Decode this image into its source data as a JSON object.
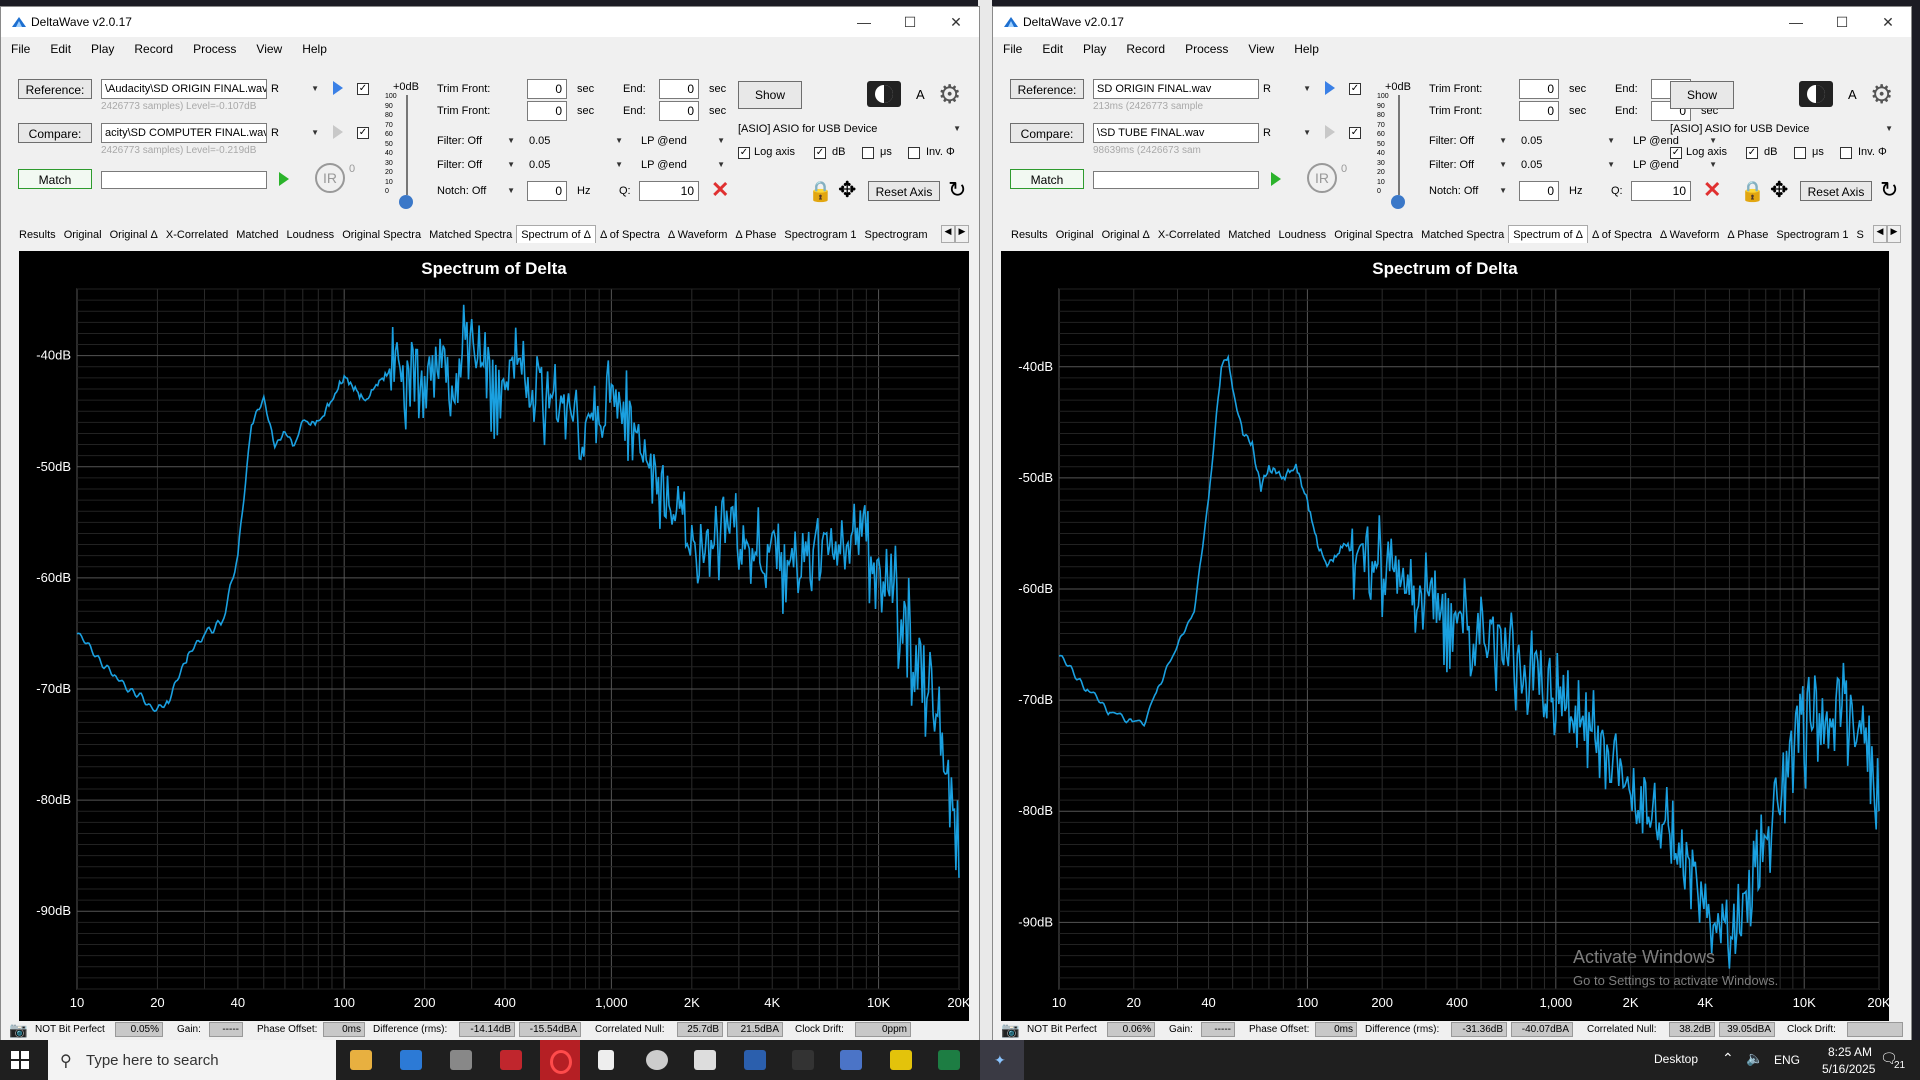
{
  "windows": [
    {
      "title": "DeltaWave v2.0.17",
      "menu": [
        "File",
        "Edit",
        "Play",
        "Record",
        "Process",
        "View",
        "Help"
      ],
      "reference_button": "Reference:",
      "reference_file": "\\Audacity\\SD ORIGIN FINAL.wav",
      "reference_channel": "R",
      "reference_info": "2426773 samples) Level=-0.107dB",
      "compare_button": "Compare:",
      "compare_file": "acity\\SD COMPUTER FINAL.wav",
      "compare_channel": "R",
      "compare_info": "2426773 samples) Level=-0.219dB",
      "match_button": "Match",
      "ir_label": "IR",
      "ir_count": "0",
      "level_label": "+0dB",
      "level_ticks": [
        "100",
        "90",
        "80",
        "70",
        "60",
        "50",
        "40",
        "30",
        "20",
        "10",
        "0"
      ],
      "trim_front_label": "Trim Front:",
      "trim_front_ref": "0",
      "trim_front_cmp": "0",
      "sec_label": "sec",
      "end_label": "End:",
      "end_ref": "0",
      "end_cmp": "0",
      "filter1": "Filter: Off",
      "filter1_val": "0.05",
      "filter1_lp": "LP @end",
      "filter2": "Filter: Off",
      "filter2_val": "0.05",
      "filter2_lp": "LP @end",
      "notch": "Notch: Off",
      "notch_val": "0",
      "hz_label": "Hz",
      "q_label": "Q:",
      "q_val": "10",
      "show_button": "Show",
      "a_label": "A",
      "device": "[ASIO] ASIO for USB Device",
      "log_axis": "Log axis",
      "db": "dB",
      "us": "μs",
      "inv": "Inv. Φ",
      "reset_axis": "Reset Axis",
      "tabs": [
        "Results",
        "Original",
        "Original Δ",
        "X-Correlated",
        "Matched",
        "Loudness",
        "Original Spectra",
        "Matched Spectra",
        "Spectrum of Δ",
        "Δ of Spectra",
        "Δ Waveform",
        "Δ Phase",
        "Spectrogram 1",
        "Spectrogram"
      ],
      "active_tab": "Spectrum of Δ",
      "status": {
        "bit": "NOT Bit Perfect",
        "bit_val": "0.05%",
        "gain": "Gain:",
        "gain_val": "-----",
        "phase": "Phase Offset:",
        "phase_val": "0ms",
        "diff": "Difference (rms):",
        "diff_val": "-14.14dB",
        "diff_val2": "-15.54dBA",
        "null": "Correlated Null:",
        "null_val": "25.7dB",
        "null_val2": "21.5dBA",
        "drift": "Clock Drift:",
        "drift_val": "0ppm"
      },
      "chart_data": {
        "type": "line",
        "title": "Spectrum of Delta",
        "xscale": "log",
        "x_ticks": [
          "10",
          "20",
          "40",
          "100",
          "200",
          "400",
          "1,000",
          "2K",
          "4K",
          "10K",
          "20K"
        ],
        "y_ticks": [
          "-40dB",
          "-50dB",
          "-60dB",
          "-70dB",
          "-80dB",
          "-90dB"
        ],
        "xlim": [
          10,
          20000
        ],
        "ylim": [
          -97,
          -34
        ],
        "grid": true,
        "color": "#1aa0e0",
        "series": [
          {
            "x": [
              10,
              14,
              20,
              22,
              26,
              30,
              35,
              40,
              45,
              50,
              55,
              60,
              65,
              70,
              80,
              90,
              100,
              110,
              120,
              130,
              150,
              170,
              200,
              220,
              250,
              280,
              300,
              350,
              400,
              450,
              500,
              600,
              700,
              800,
              1000,
              1200,
              1500,
              1800,
              2000,
              2300,
              2700,
              3000,
              3500,
              4000,
              4500,
              5000,
              6000,
              7000,
              8000,
              9000,
              10000,
              11000,
              12000,
              14000,
              16000,
              18000,
              20000
            ],
            "y": [
              -65,
              -69,
              -72,
              -71,
              -67,
              -65,
              -64,
              -58,
              -46,
              -44,
              -48,
              -47,
              -48,
              -46,
              -46,
              -44,
              -42,
              -43,
              -44,
              -43,
              -41,
              -42,
              -43,
              -41,
              -42,
              -40,
              -41,
              -42,
              -43,
              -41,
              -43,
              -44,
              -45,
              -47,
              -44,
              -46,
              -52,
              -55,
              -56,
              -57,
              -55,
              -56,
              -58,
              -58,
              -60,
              -59,
              -57,
              -57,
              -56,
              -58,
              -58,
              -59,
              -63,
              -67,
              -70,
              -76,
              -87
            ]
          }
        ]
      }
    },
    {
      "title": "DeltaWave v2.0.17",
      "menu": [
        "File",
        "Edit",
        "Play",
        "Record",
        "Process",
        "View",
        "Help"
      ],
      "reference_button": "Reference:",
      "reference_file": "SD ORIGIN FINAL.wav",
      "reference_channel": "R",
      "reference_info": "213ms (2426773 sample",
      "compare_button": "Compare:",
      "compare_file": "\\SD TUBE FINAL.wav",
      "compare_channel": "R",
      "compare_info": "98639ms (2426673 sam",
      "match_button": "Match",
      "ir_label": "IR",
      "ir_count": "0",
      "level_label": "+0dB",
      "level_ticks": [
        "100",
        "90",
        "80",
        "70",
        "60",
        "50",
        "40",
        "30",
        "20",
        "10",
        "0"
      ],
      "trim_front_label": "Trim Front:",
      "trim_front_ref": "0",
      "trim_front_cmp": "0",
      "sec_label": "sec",
      "end_label": "End:",
      "end_ref": "0",
      "end_cmp": "0",
      "filter1": "Filter: Off",
      "filter1_val": "0.05",
      "filter1_lp": "LP @end",
      "filter2": "Filter: Off",
      "filter2_val": "0.05",
      "filter2_lp": "LP @end",
      "notch": "Notch: Off",
      "notch_val": "0",
      "hz_label": "Hz",
      "q_label": "Q:",
      "q_val": "10",
      "show_button": "Show",
      "a_label": "A",
      "device": "[ASIO] ASIO for USB Device",
      "log_axis": "Log axis",
      "db": "dB",
      "us": "μs",
      "inv": "Inv. Φ",
      "reset_axis": "Reset Axis",
      "tabs": [
        "Results",
        "Original",
        "Original Δ",
        "X-Correlated",
        "Matched",
        "Loudness",
        "Original Spectra",
        "Matched Spectra",
        "Spectrum of Δ",
        "Δ of Spectra",
        "Δ Waveform",
        "Δ Phase",
        "Spectrogram 1",
        "S"
      ],
      "active_tab": "Spectrum of Δ",
      "status": {
        "bit": "NOT Bit Perfect",
        "bit_val": "0.06%",
        "gain": "Gain:",
        "gain_val": "-----",
        "phase": "Phase Offset:",
        "phase_val": "0ms",
        "diff": "Difference (rms):",
        "diff_val": "-31.36dB",
        "diff_val2": "-40.07dBA",
        "null": "Correlated Null:",
        "null_val": "38.2dB",
        "null_val2": "39.05dBA",
        "drift": "Clock Drift:",
        "drift_val": ""
      },
      "watermark": {
        "title": "Activate Windows",
        "subtitle": "Go to Settings to activate Windows."
      },
      "chart_data": {
        "type": "line",
        "title": "Spectrum of Delta",
        "xscale": "log",
        "x_ticks": [
          "10",
          "20",
          "40",
          "100",
          "200",
          "400",
          "1,000",
          "2K",
          "4K",
          "10K",
          "20K"
        ],
        "y_ticks": [
          "-40dB",
          "-50dB",
          "-60dB",
          "-70dB",
          "-80dB",
          "-90dB"
        ],
        "xlim": [
          10,
          20000
        ],
        "ylim": [
          -96,
          -33
        ],
        "grid": true,
        "color": "#1aa0e0",
        "series": [
          {
            "x": [
              10,
              13,
              16,
              20,
              22,
              25,
              30,
              35,
              40,
              45,
              48,
              50,
              55,
              60,
              65,
              70,
              80,
              90,
              100,
              110,
              120,
              140,
              160,
              180,
              200,
              250,
              300,
              350,
              400,
              500,
              600,
              700,
              800,
              1000,
              1200,
              1500,
              2000,
              2500,
              3000,
              3500,
              4000,
              4500,
              5000,
              5500,
              6000,
              7000,
              8000,
              9000,
              10000,
              12000,
              14000,
              16000,
              18000,
              20000
            ],
            "y": [
              -66,
              -69,
              -71,
              -72,
              -72,
              -69,
              -65,
              -62,
              -52,
              -40,
              -39,
              -42,
              -46,
              -47,
              -51,
              -49,
              -50,
              -49,
              -52,
              -56,
              -58,
              -56,
              -57,
              -59,
              -58,
              -60,
              -61,
              -62,
              -63,
              -64,
              -65,
              -66,
              -68,
              -69,
              -71,
              -74,
              -78,
              -80,
              -83,
              -86,
              -88,
              -90,
              -91,
              -90,
              -87,
              -83,
              -78,
              -74,
              -72,
              -71,
              -70,
              -72,
              -74,
              -80
            ]
          }
        ]
      }
    }
  ],
  "taskbar": {
    "search_placeholder": "Type here to search",
    "desktop": "Desktop",
    "lang": "ENG",
    "time": "8:25 AM",
    "date": "5/16/2025",
    "notif": "21"
  }
}
